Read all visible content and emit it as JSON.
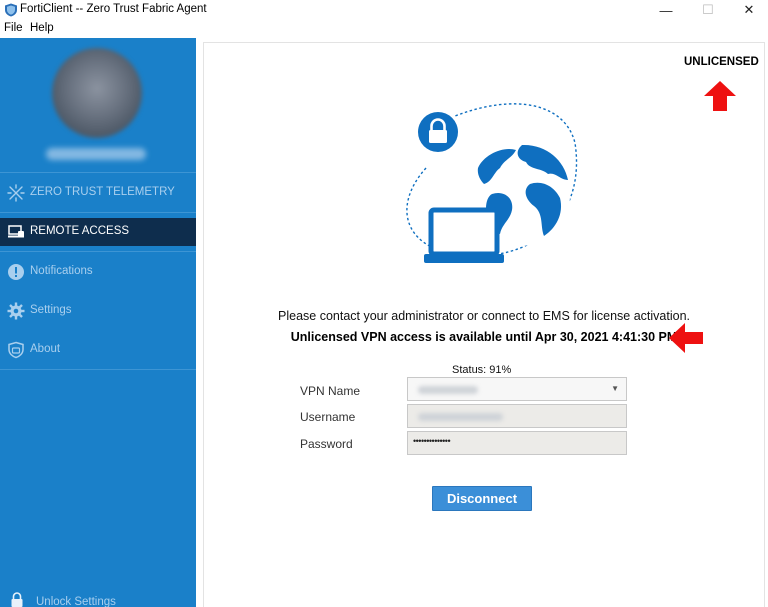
{
  "window": {
    "title": "FortiClient -- Zero Trust Fabric Agent",
    "controls": {
      "minimize": "—",
      "maximize": "☐",
      "close": "✕"
    }
  },
  "menu": {
    "file": "File",
    "help": "Help"
  },
  "sidebar": {
    "items": [
      {
        "label": "ZERO TRUST TELEMETRY",
        "icon": "zero-trust-icon",
        "active": false
      },
      {
        "label": "REMOTE ACCESS",
        "icon": "remote-access-icon",
        "active": true
      },
      {
        "label": "Notifications",
        "icon": "alert-icon",
        "active": false
      },
      {
        "label": "Settings",
        "icon": "gear-icon",
        "active": false
      },
      {
        "label": "About",
        "icon": "shield-icon",
        "active": false
      }
    ],
    "unlock_label": "Unlock Settings"
  },
  "main": {
    "license_label": "UNLICENSED",
    "message_line1": "Please contact your administrator or connect to EMS for license activation.",
    "message_line2": "Unlicensed VPN access is available until Apr 30, 2021 4:41:30 PM",
    "status": "Status: 91%",
    "form": {
      "vpn_name_label": "VPN Name",
      "username_label": "Username",
      "password_label": "Password",
      "password_mask": "••••••••••••••"
    },
    "disconnect_label": "Disconnect"
  },
  "colors": {
    "sidebar": "#1a80c9",
    "sidebar_active": "#0e2d4d",
    "brand_blue": "#0f6fc0",
    "button": "#3b8fd8",
    "annotation_arrow": "#ee1111"
  }
}
